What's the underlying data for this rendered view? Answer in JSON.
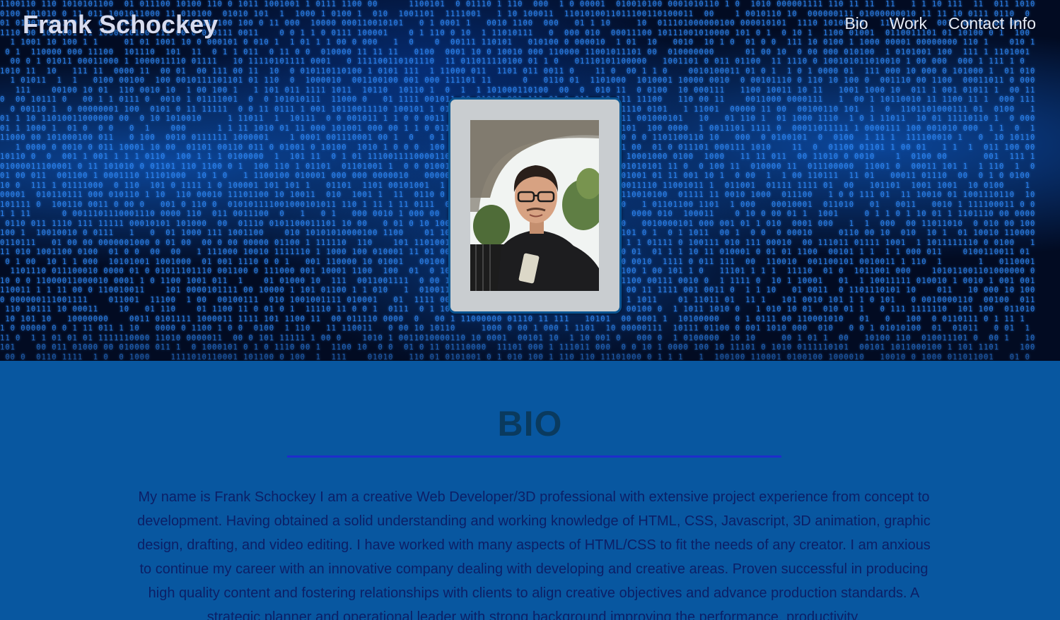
{
  "header": {
    "brand": "Frank Schockey",
    "nav": [
      "Bio",
      "Work",
      "Contact Info"
    ]
  },
  "hero": {
    "photo_alt": "Portrait of Frank Schockey"
  },
  "bio": {
    "title": "BIO",
    "text": "My name is Frank Schockey I am a creative Web Developer/3D professional with extensive project experience from concept to development. Having obtained a solid understanding and working knowledge of HTML, CSS, Javascript, 3D animation, graphic design, drafting, and video editing. I have worked with many aspects of HTML/CSS to fit the needs of any creator. I am anxious to continue my career with an innovative company dealing with developing and creative areas. Proven successful in producing high quality content and fostering relationships with clients to align creative objectives and advance production standards. A strategic planner and operational leader with strong background improving the performance, productivity,"
  },
  "colors": {
    "bio_background": "#0857a0",
    "bio_title": "#0a3a5e",
    "bio_text": "#0c1f66",
    "divider": "#1f2ccc",
    "binary_glow": "#2f8cff"
  },
  "icons": {
    "background": "binary-code-matrix"
  }
}
